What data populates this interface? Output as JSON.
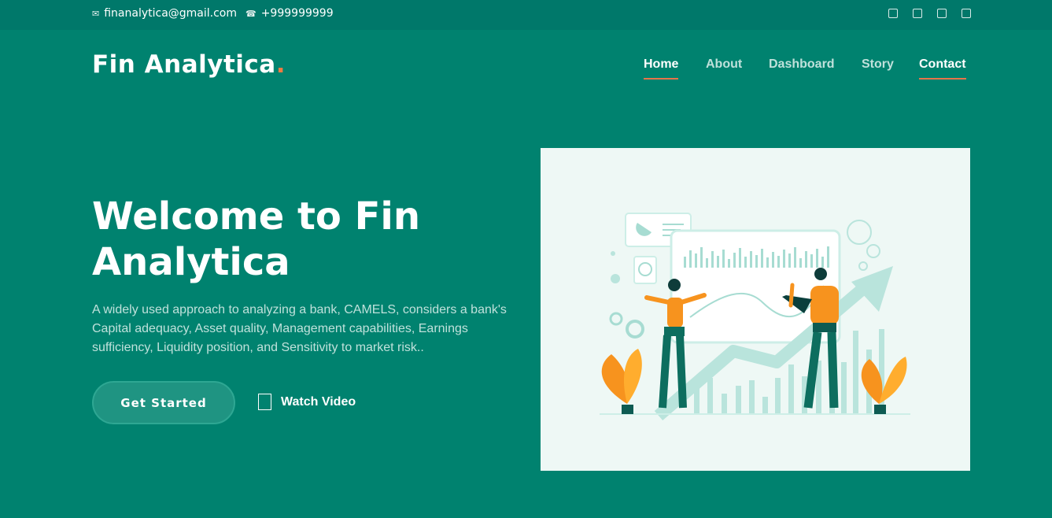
{
  "topbar": {
    "email": "finanalytica@gmail.com",
    "phone": "+999999999",
    "email_icon": "envelope-icon",
    "phone_icon": "phone-icon",
    "social_icons": [
      "twitter-icon",
      "facebook-icon",
      "instagram-icon",
      "linkedin-icon"
    ]
  },
  "brand": {
    "name": "Fin Analytica",
    "dot": "."
  },
  "nav": [
    {
      "label": "Home",
      "active": true
    },
    {
      "label": "About",
      "active": false
    },
    {
      "label": "Dashboard",
      "active": false
    },
    {
      "label": "Story",
      "active": false
    },
    {
      "label": "Contact",
      "active": true
    }
  ],
  "hero": {
    "title_line1": "Welcome to Fin",
    "title_line2": "Analytica",
    "description": "A widely used approach to analyzing a bank, CAMELS, considers a bank's Capital adequacy, Asset quality, Management capabilities, Earnings sufficiency, Liquidity position, and Sensitivity to market risk..",
    "cta_label": "Get Started",
    "video_label": "Watch Video",
    "video_icon": "play-icon"
  },
  "colors": {
    "background": "#00826f",
    "topbar": "#00786a",
    "accent": "#e8744a",
    "illustration_bg": "#eef8f5"
  }
}
